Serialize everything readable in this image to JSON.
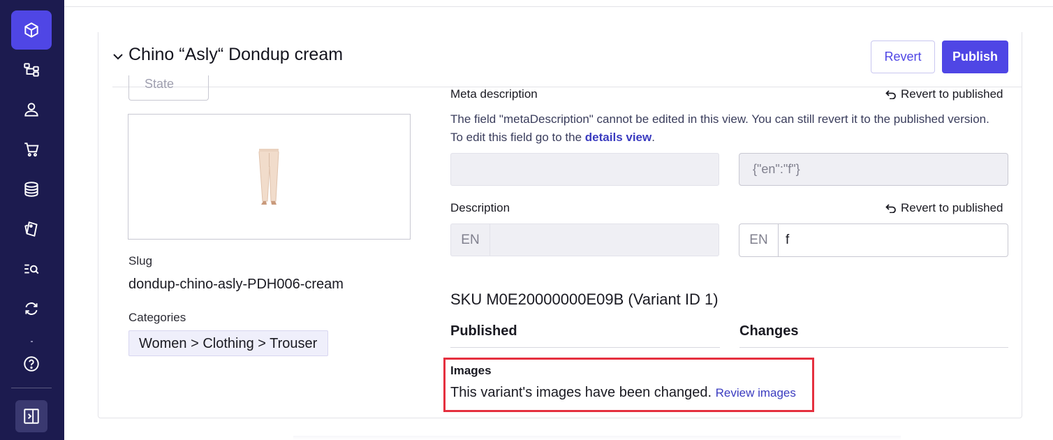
{
  "sidebar": {
    "items": [
      {
        "icon": "cube-icon",
        "active": true
      },
      {
        "icon": "hierarchy-icon"
      },
      {
        "icon": "user-icon"
      },
      {
        "icon": "cart-icon"
      },
      {
        "icon": "coins-icon"
      },
      {
        "icon": "tags-icon"
      },
      {
        "icon": "search-list-icon"
      },
      {
        "icon": "sync-icon"
      }
    ],
    "help_icon": "help-icon",
    "panel_icon": "panel-toggle-icon",
    "colors": {
      "background": "#1c1b4f",
      "active": "#4f46e5"
    }
  },
  "header": {
    "title": "Chino “Asly“ Dondup cream",
    "revert_label": "Revert",
    "publish_label": "Publish"
  },
  "left": {
    "state_label": "State",
    "slug_label": "Slug",
    "slug_value": "dondup-chino-asly-PDH006-cream",
    "categories_label": "Categories",
    "category_path": "Women > Clothing > Trouser"
  },
  "meta": {
    "label": "Meta description",
    "revert_label": "Revert to published",
    "help_part1": "The field \"metaDescription\" cannot be edited in this view. You can still revert it to the published version. To edit this field go to the ",
    "help_link": "details view",
    "help_part2": ".",
    "changed_value": "{\"en\":\"f\"}"
  },
  "description": {
    "label": "Description",
    "revert_label": "Revert to published",
    "published_lang": "EN",
    "published_value": "",
    "changed_lang": "EN",
    "changed_value": "f"
  },
  "variant": {
    "sku_title": "SKU M0E20000000E09B (Variant ID 1)",
    "published_header": "Published",
    "changes_header": "Changes",
    "images_label": "Images",
    "images_message": "This variant's images have been changed.",
    "review_link": "Review images"
  },
  "colors": {
    "accent": "#4f46e5",
    "highlight": "#e5303f",
    "link": "#3b3cc0"
  }
}
